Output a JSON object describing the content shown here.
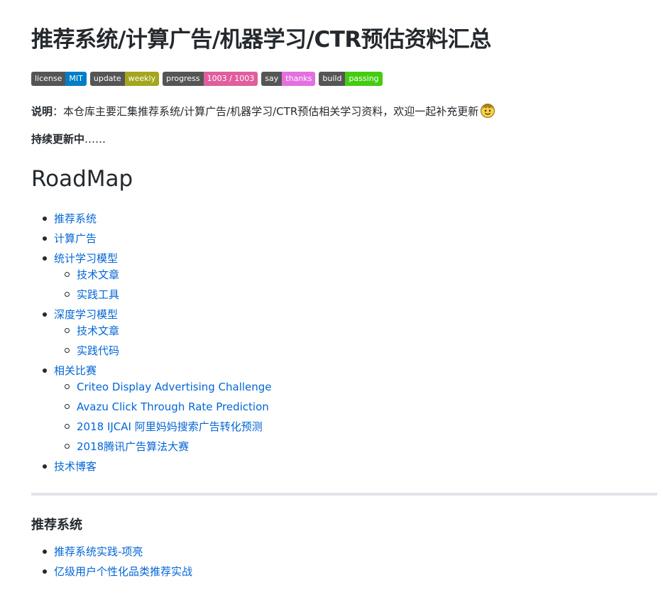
{
  "title": "推荐系统/计算广告/机器学习/CTR预估资料汇总",
  "badges": [
    {
      "label": "license",
      "value": "MIT",
      "color": "#007ec6"
    },
    {
      "label": "update",
      "value": "weekly",
      "color": "#a4a61d"
    },
    {
      "label": "progress",
      "value": "1003 / 1003",
      "color": "#e05d9e"
    },
    {
      "label": "say",
      "value": "thanks",
      "color": "#e46fe0"
    },
    {
      "label": "build",
      "value": "passing",
      "color": "#4c1"
    }
  ],
  "intro": {
    "label": "说明",
    "text": "：本仓库主要汇集推荐系统/计算广告/机器学习/CTR预估相关学习资料，欢迎一起补充更新",
    "emoji": "smiling-face-emoji"
  },
  "updating": {
    "bold": "持续更新中",
    "dots": "……"
  },
  "roadmap_heading": "RoadMap",
  "roadmap": {
    "item1": "推荐系统",
    "item2": "计算广告",
    "item3": "统计学习模型",
    "item3_sub": [
      "技术文章",
      "实践工具"
    ],
    "item4": "深度学习模型",
    "item4_sub": [
      "技术文章",
      "实践代码"
    ],
    "item5": "相关比赛",
    "item5_sub": [
      "Criteo Display Advertising Challenge",
      "Avazu Click Through Rate Prediction",
      "2018 IJCAI 阿里妈妈搜索广告转化预测",
      "2018腾讯广告算法大赛"
    ],
    "item6": "技术博客"
  },
  "section_heading": "推荐系统",
  "rec_links": [
    "推荐系统实践-项亮",
    "亿级用户个性化品类推荐实战"
  ],
  "colors": {
    "link": "#0366d6",
    "text": "#24292e",
    "rule": "#e1e4e8"
  }
}
